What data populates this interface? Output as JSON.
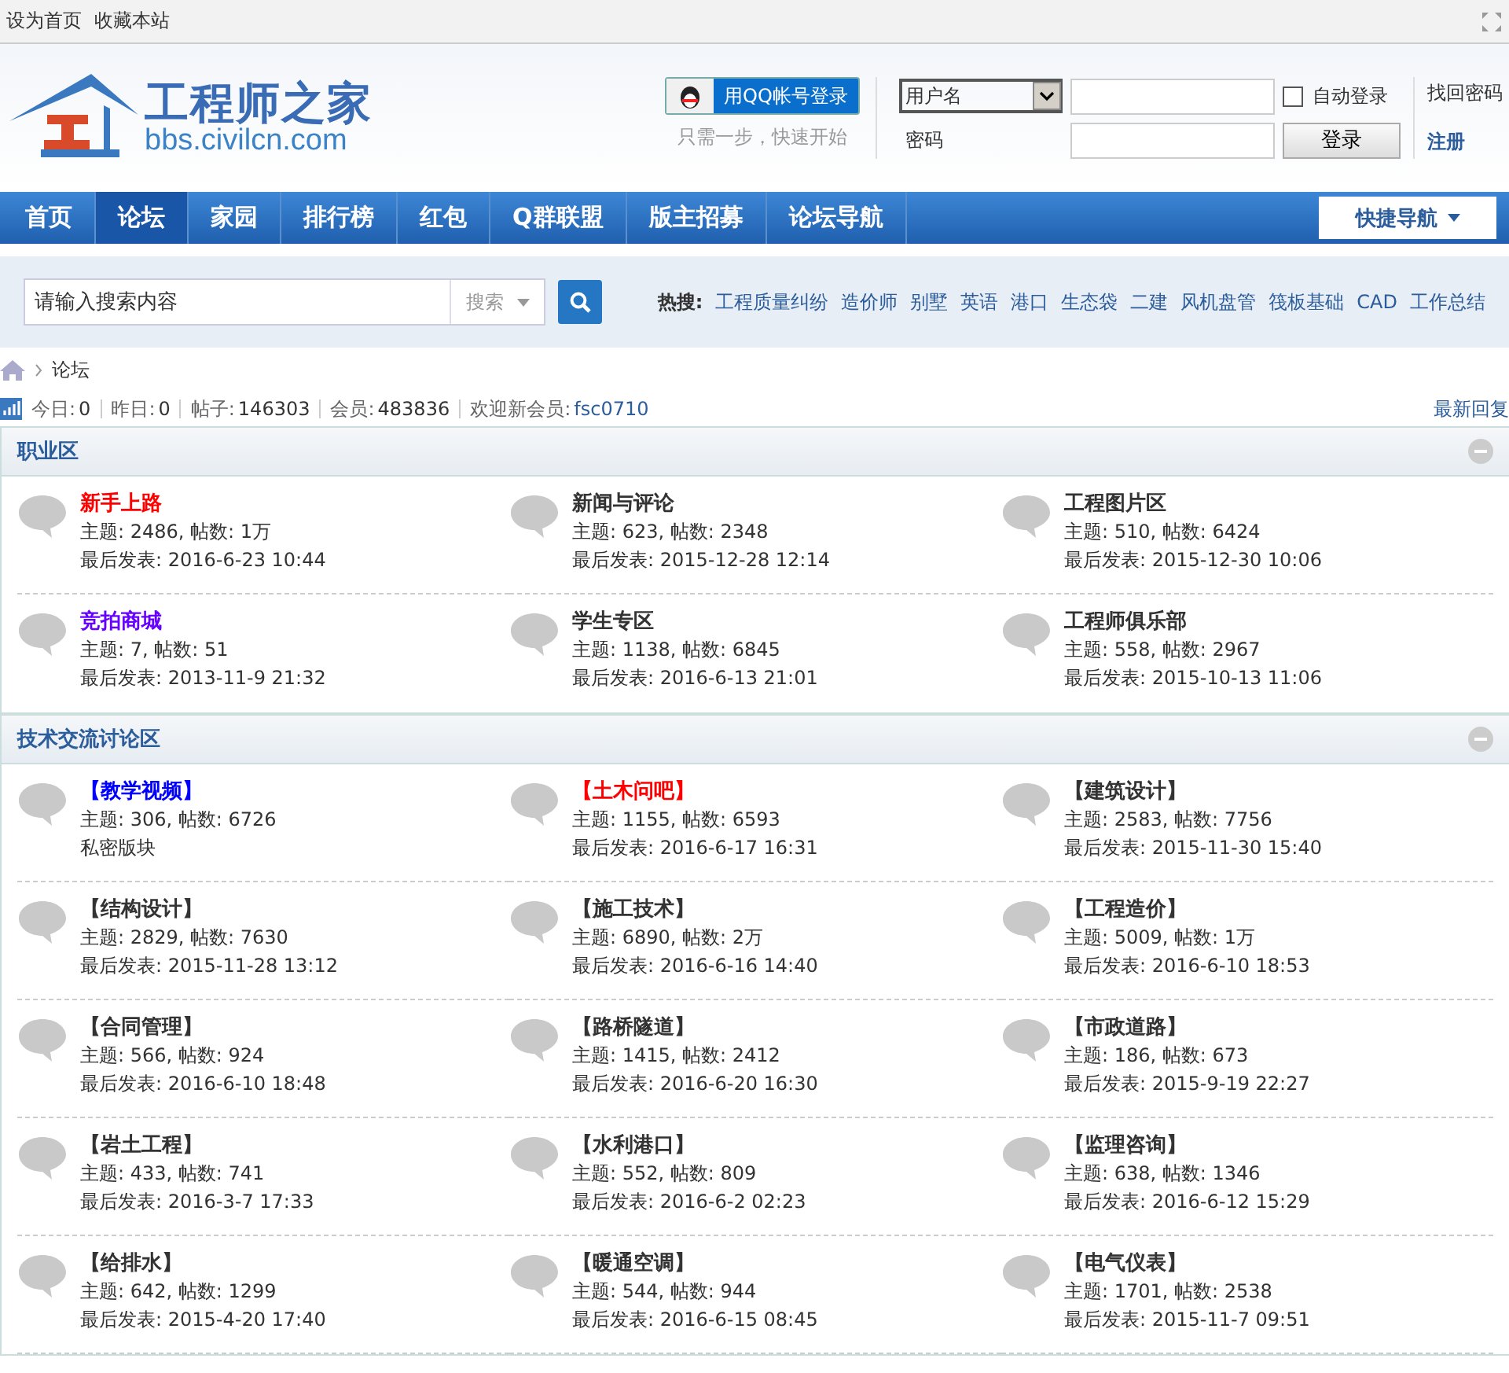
{
  "topbar": {
    "links": [
      "设为首页",
      "收藏本站"
    ]
  },
  "logo": {
    "title": "工程师之家",
    "url": "bbs.civilcn.com"
  },
  "qq_login": {
    "button": "用QQ帐号登录",
    "hint": "只需一步，快速开始"
  },
  "login": {
    "account_type": "用户名",
    "password_label": "密码",
    "auto_login": {
      "label": "自动登录",
      "checked": false
    },
    "submit": "登录",
    "forgot": "找回密码",
    "register": "注册"
  },
  "nav": {
    "items": [
      {
        "label": "首页",
        "selected": false
      },
      {
        "label": "论坛",
        "selected": true
      },
      {
        "label": "家园",
        "selected": false
      },
      {
        "label": "排行榜",
        "selected": false
      },
      {
        "label": "红包",
        "selected": false
      },
      {
        "label": "Q群联盟",
        "selected": false
      },
      {
        "label": "版主招募",
        "selected": false
      },
      {
        "label": "论坛导航",
        "selected": false
      }
    ],
    "quick": "快捷导航"
  },
  "search": {
    "placeholder": "请输入搜索内容",
    "scope": "搜索",
    "hot_label": "热搜:",
    "hot": [
      "工程质量纠纷",
      "造价师",
      "别墅",
      "英语",
      "港口",
      "生态袋",
      "二建",
      "风机盘管",
      "筏板基础",
      "CAD",
      "工作总结"
    ]
  },
  "breadcrumb": [
    "论坛"
  ],
  "stats": [
    {
      "label": "今日:",
      "value": "0"
    },
    {
      "label": "昨日:",
      "value": "0"
    },
    {
      "label": "帖子:",
      "value": "146303"
    },
    {
      "label": "会员:",
      "value": "483836"
    },
    {
      "label": "欢迎新会员:",
      "value": "fsc0710"
    }
  ],
  "latest_link": "最新回复",
  "sections": [
    {
      "title": "职业区",
      "forums": [
        {
          "name": "新手上路",
          "color": "#ff0000",
          "counts": "主题: 2486, 帖数: 1万",
          "last": "最后发表: 2016-6-23 10:44"
        },
        {
          "name": "新闻与评论",
          "color": "#333333",
          "counts": "主题: 623, 帖数: 2348",
          "last": "最后发表: 2015-12-28 12:14"
        },
        {
          "name": "工程图片区",
          "color": "#333333",
          "counts": "主题: 510, 帖数: 6424",
          "last": "最后发表: 2015-12-30 10:06"
        },
        {
          "name": "竞拍商城",
          "color": "#6600ff",
          "counts": "主题: 7, 帖数: 51",
          "last": "最后发表: 2013-11-9 21:32"
        },
        {
          "name": "学生专区",
          "color": "#333333",
          "counts": "主题: 1138, 帖数: 6845",
          "last": "最后发表: 2016-6-13 21:01"
        },
        {
          "name": "工程师俱乐部",
          "color": "#333333",
          "counts": "主题: 558, 帖数: 2967",
          "last": "最后发表: 2015-10-13 11:06"
        }
      ]
    },
    {
      "title": "技术交流讨论区",
      "forums": [
        {
          "name": "【教学视频】",
          "color": "#0000ff",
          "counts": "主题: 306, 帖数: 6726",
          "last": "私密版块"
        },
        {
          "name": "【土木问吧】",
          "color": "#ff0000",
          "counts": "主题: 1155, 帖数: 6593",
          "last": "最后发表: 2016-6-17 16:31"
        },
        {
          "name": "【建筑设计】",
          "color": "#333333",
          "counts": "主题: 2583, 帖数: 7756",
          "last": "最后发表: 2015-11-30 15:40"
        },
        {
          "name": "【结构设计】",
          "color": "#333333",
          "counts": "主题: 2829, 帖数: 7630",
          "last": "最后发表: 2015-11-28 13:12"
        },
        {
          "name": "【施工技术】",
          "color": "#333333",
          "counts": "主题: 6890, 帖数: 2万",
          "last": "最后发表: 2016-6-16 14:40"
        },
        {
          "name": "【工程造价】",
          "color": "#333333",
          "counts": "主题: 5009, 帖数: 1万",
          "last": "最后发表: 2016-6-10 18:53"
        },
        {
          "name": "【合同管理】",
          "color": "#333333",
          "counts": "主题: 566, 帖数: 924",
          "last": "最后发表: 2016-6-10 18:48"
        },
        {
          "name": "【路桥隧道】",
          "color": "#333333",
          "counts": "主题: 1415, 帖数: 2412",
          "last": "最后发表: 2016-6-20 16:30"
        },
        {
          "name": "【市政道路】",
          "color": "#333333",
          "counts": "主题: 186, 帖数: 673",
          "last": "最后发表: 2015-9-19 22:27"
        },
        {
          "name": "【岩土工程】",
          "color": "#333333",
          "counts": "主题: 433, 帖数: 741",
          "last": "最后发表: 2016-3-7 17:33"
        },
        {
          "name": "【水利港口】",
          "color": "#333333",
          "counts": "主题: 552, 帖数: 809",
          "last": "最后发表: 2016-6-2 02:23"
        },
        {
          "name": "【监理咨询】",
          "color": "#333333",
          "counts": "主题: 638, 帖数: 1346",
          "last": "最后发表: 2016-6-12 15:29"
        },
        {
          "name": "【给排水】",
          "color": "#333333",
          "counts": "主题: 642, 帖数: 1299",
          "last": "最后发表: 2015-4-20 17:40"
        },
        {
          "name": "【暖通空调】",
          "color": "#333333",
          "counts": "主题: 544, 帖数: 944",
          "last": "最后发表: 2016-6-15 08:45"
        },
        {
          "name": "【电气仪表】",
          "color": "#333333",
          "counts": "主题: 1701, 帖数: 2538",
          "last": "最后发表: 2015-11-7 09:51"
        }
      ]
    }
  ]
}
